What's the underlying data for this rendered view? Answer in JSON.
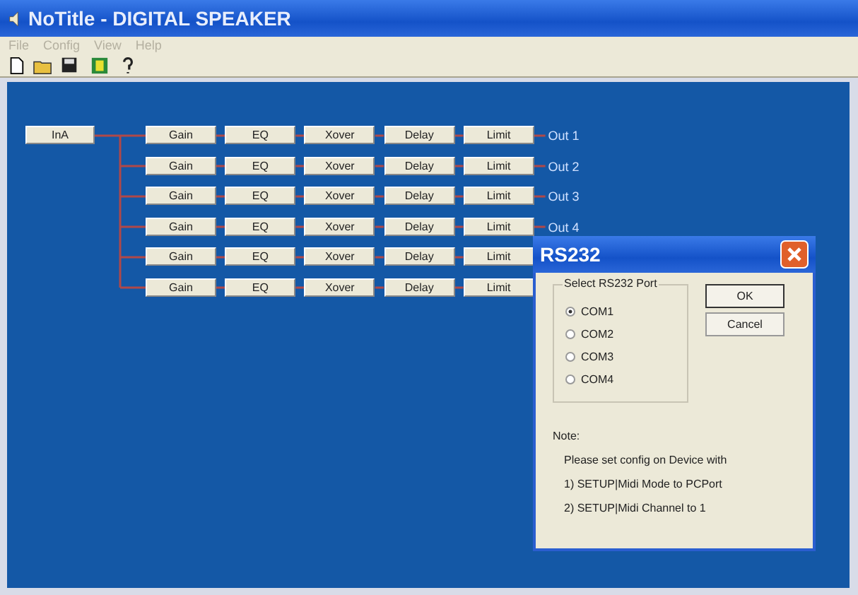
{
  "window": {
    "title": "NoTitle - DIGITAL SPEAKER"
  },
  "menu": [
    {
      "label": "File",
      "disabled": true
    },
    {
      "label": "Config",
      "disabled": true
    },
    {
      "label": "View",
      "disabled": true
    },
    {
      "label": "Help",
      "disabled": true
    }
  ],
  "toolbar": [
    {
      "kind": "new"
    },
    {
      "kind": "open"
    },
    {
      "kind": "save"
    },
    {
      "kind": "device"
    },
    {
      "kind": "help"
    }
  ],
  "diagram": {
    "input": "InA",
    "rows": [
      {
        "blocks": [
          "Gain",
          "EQ",
          "Xover",
          "Delay",
          "Limit"
        ],
        "output": "Out 1"
      },
      {
        "blocks": [
          "Gain",
          "EQ",
          "Xover",
          "Delay",
          "Limit"
        ],
        "output": "Out 2"
      },
      {
        "blocks": [
          "Gain",
          "EQ",
          "Xover",
          "Delay",
          "Limit"
        ],
        "output": "Out 3"
      },
      {
        "blocks": [
          "Gain",
          "EQ",
          "Xover",
          "Delay",
          "Limit"
        ],
        "output": "Out 4"
      },
      {
        "blocks": [
          "Gain",
          "EQ",
          "Xover",
          "Delay",
          "Limit"
        ]
      },
      {
        "blocks": [
          "Gain",
          "EQ",
          "Xover",
          "Delay",
          "Limit"
        ]
      }
    ]
  },
  "dialog": {
    "title": "RS232",
    "group_label": "Select RS232 Port",
    "ports": [
      {
        "label": "COM1",
        "selected": true
      },
      {
        "label": "COM2",
        "selected": false
      },
      {
        "label": "COM3",
        "selected": false
      },
      {
        "label": "COM4",
        "selected": false
      }
    ],
    "buttons": [
      "OK",
      "Cancel"
    ],
    "note_title": "Note:",
    "note_lines": [
      "Please set config on Device with",
      "1) SETUP|Midi Mode to PCPort",
      "2) SETUP|Midi Channel to 1"
    ]
  }
}
